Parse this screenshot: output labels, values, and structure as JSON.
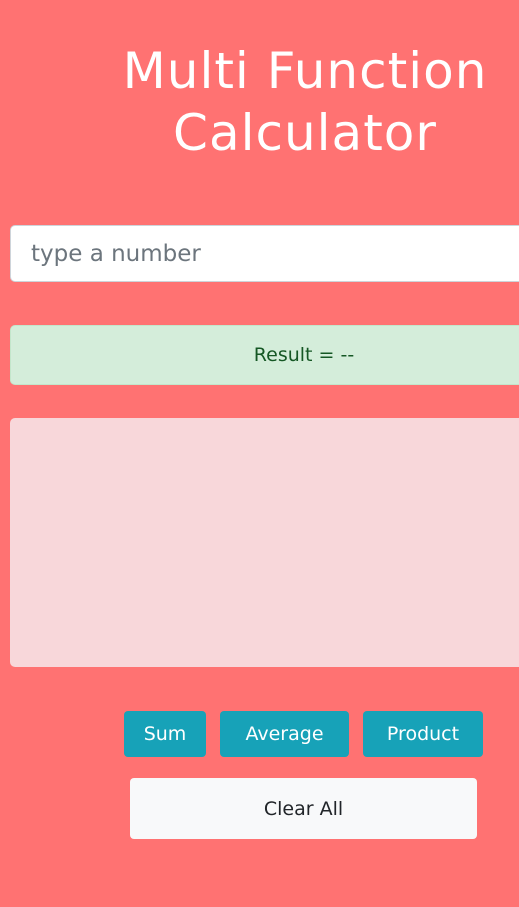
{
  "app": {
    "title_line1": "Multi Function",
    "title_line2": "Calculator"
  },
  "input": {
    "placeholder": "type a number",
    "value": ""
  },
  "result": {
    "text": "Result = --"
  },
  "numbers_list": {
    "items": []
  },
  "buttons": {
    "sum": "Sum",
    "average": "Average",
    "product": "Product",
    "clear_all": "Clear All"
  },
  "colors": {
    "background": "#ff7272",
    "result_bg": "#d4edda",
    "list_bg": "#f8d7da",
    "info_button": "#17a2b8",
    "clear_button": "#f8f9fa"
  }
}
